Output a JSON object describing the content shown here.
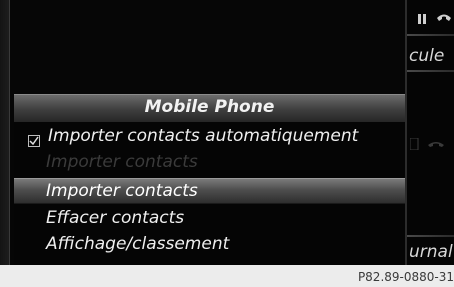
{
  "background": {
    "right_top_text": "cule",
    "right_bottom_text": "urnal",
    "status_icons": [
      "signal-bars-icon",
      "phone-icon"
    ]
  },
  "menu": {
    "title": "Mobile Phone",
    "items": [
      {
        "label": "Importer contacts automatiquement",
        "type": "checkbox",
        "checked": true,
        "state": "enabled"
      },
      {
        "label": "Importer contacts",
        "type": "action",
        "state": "disabled"
      },
      {
        "label": "Importer contacts",
        "type": "action",
        "state": "selected"
      },
      {
        "label": "Effacer contacts",
        "type": "action",
        "state": "enabled"
      },
      {
        "label": "Affichage/classement",
        "type": "action",
        "state": "enabled"
      }
    ]
  },
  "caption": "P82.89-0880-31",
  "colors": {
    "screen_bg": "#060606",
    "text": "#efefef",
    "disabled_text": "#3b3b3b",
    "highlight": "#5a5a5a"
  }
}
